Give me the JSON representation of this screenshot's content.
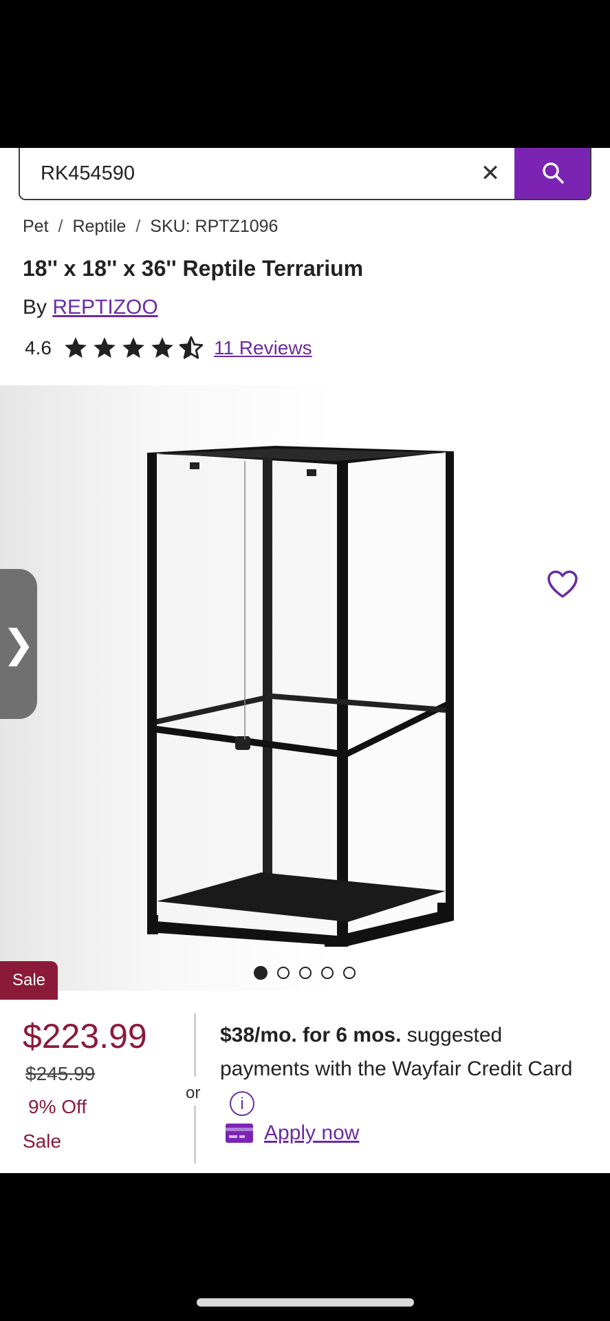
{
  "search": {
    "value": "RK454590"
  },
  "breadcrumb": {
    "items": [
      "Pet",
      "Reptile",
      "SKU: RPTZ1096"
    ],
    "separator": "/"
  },
  "product": {
    "title": "18'' x 18'' x 36'' Reptile Terrarium",
    "by_prefix": "By",
    "brand": "REPTIZOO",
    "rating": "4.6",
    "rating_value": 4.6,
    "reviews_label": "11 Reviews"
  },
  "gallery": {
    "dot_count": 5,
    "active_index": 0
  },
  "sale_tag": "Sale",
  "pricing": {
    "price": "$223.99",
    "was": "$245.99",
    "discount": "9% Off",
    "sale_label": "Sale",
    "or": "or"
  },
  "credit": {
    "bold": "$38/mo. for 6 mos.",
    "rest": " suggested payments with the Wayfair Credit Card",
    "apply_label": "Apply now"
  },
  "colors": {
    "accent": "#7b24b3",
    "link": "#6b2aa3",
    "sale": "#8b1a3a"
  }
}
